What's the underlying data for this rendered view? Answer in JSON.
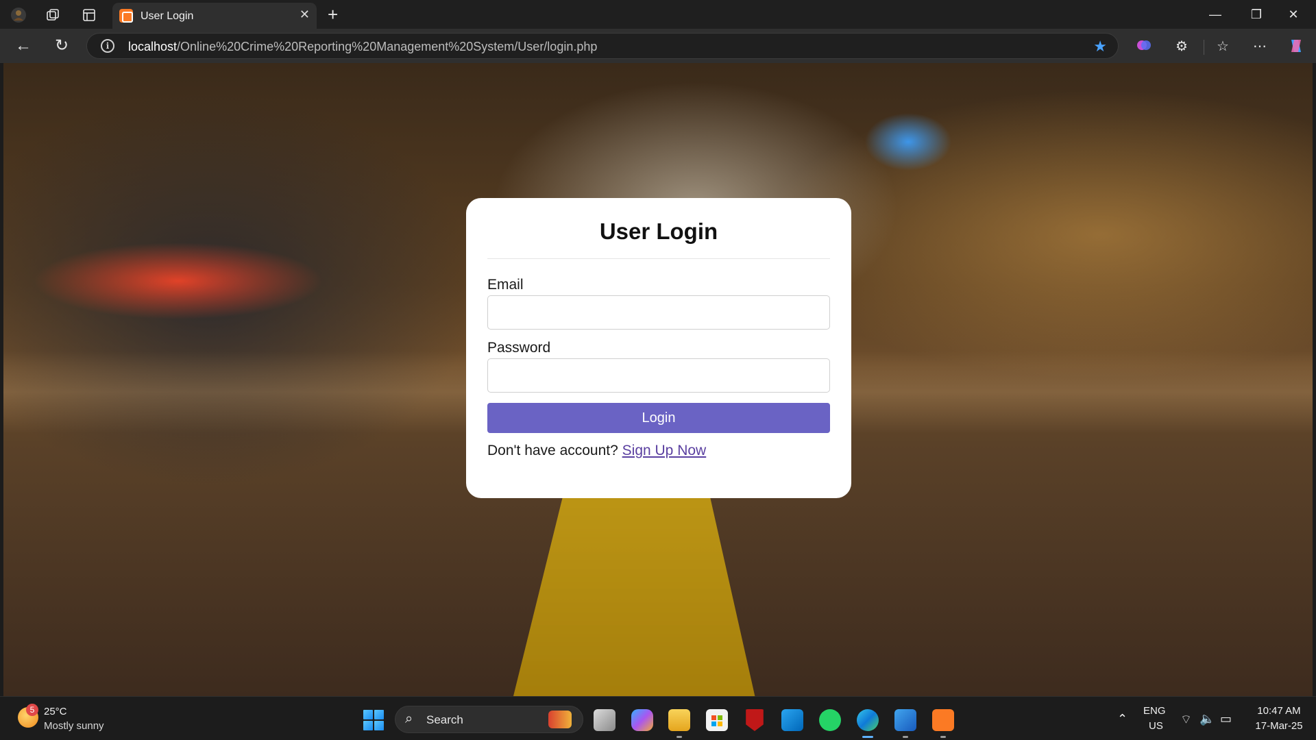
{
  "browser": {
    "tab_title": "User Login",
    "tab_close": "✕",
    "new_tab": "+",
    "url_host": "localhost",
    "url_path": "/Online%20Crime%20Reporting%20Management%20System/User/login.php"
  },
  "login_form": {
    "title": "User Login",
    "email_label": "Email",
    "email_value": "",
    "password_label": "Password",
    "password_value": "",
    "login_button": "Login",
    "signup_prompt": "Don't have account?",
    "signup_link": "Sign Up Now"
  },
  "taskbar": {
    "weather_badge": "5",
    "weather_temp": "25°C",
    "weather_desc": "Mostly sunny",
    "search_label": "Search",
    "language_top": "ENG",
    "language_bottom": "US",
    "time": "10:47 AM",
    "date": "17-Mar-25"
  },
  "colors": {
    "accent_button": "#6a63c4",
    "link": "#5a3fa0",
    "bookmark_star": "#4aa3ff",
    "tab_favicon": "#fb7a24"
  },
  "icons": {
    "taskbar_apps": [
      "task-view-icon",
      "copilot-icon",
      "file-explorer-icon",
      "microsoft-store-icon",
      "mcafee-icon",
      "vscode-icon",
      "whatsapp-icon",
      "edge-icon",
      "word-icon",
      "xampp-icon"
    ]
  }
}
